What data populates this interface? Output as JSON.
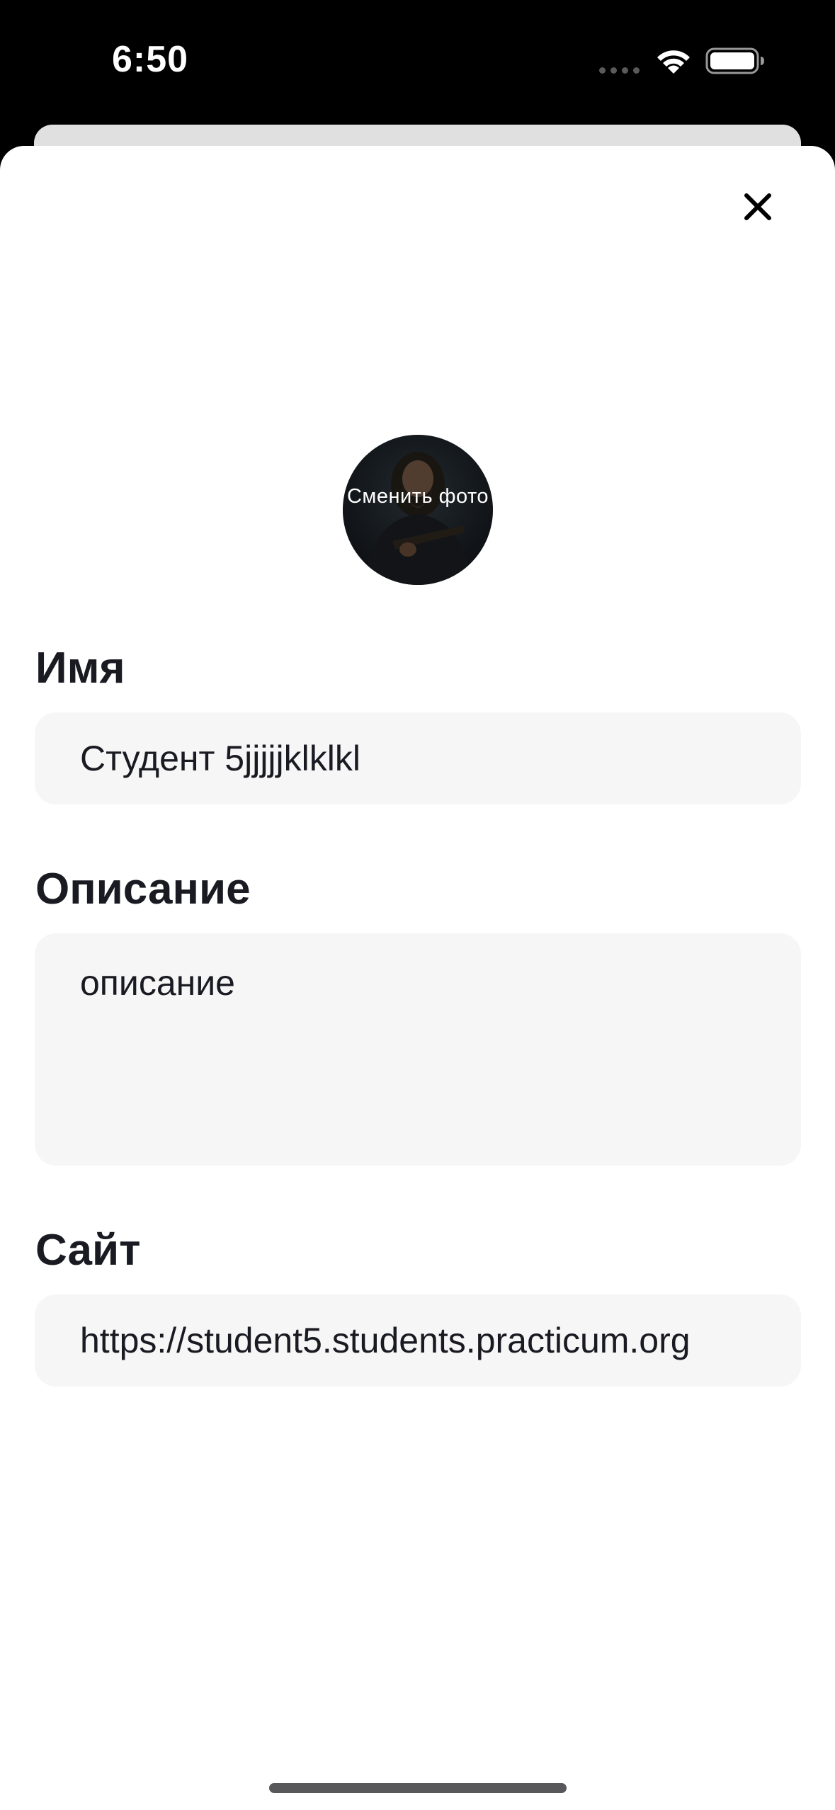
{
  "status_bar": {
    "time": "6:50",
    "icons": [
      "signal-dots-icon",
      "wifi-icon",
      "battery-icon"
    ]
  },
  "sheet": {
    "close_icon": "close-icon",
    "avatar": {
      "label": "Сменить фото"
    },
    "name": {
      "label": "Имя",
      "value": "Студент 5jjjjjklklkl"
    },
    "description": {
      "label": "Описание",
      "value": "описание"
    },
    "site": {
      "label": "Сайт",
      "value": "https://student5.students.practicum.org"
    }
  },
  "colors": {
    "background": "#000000",
    "sheet": "#ffffff",
    "field": "#f6f6f6",
    "text": "#1a1b22"
  }
}
